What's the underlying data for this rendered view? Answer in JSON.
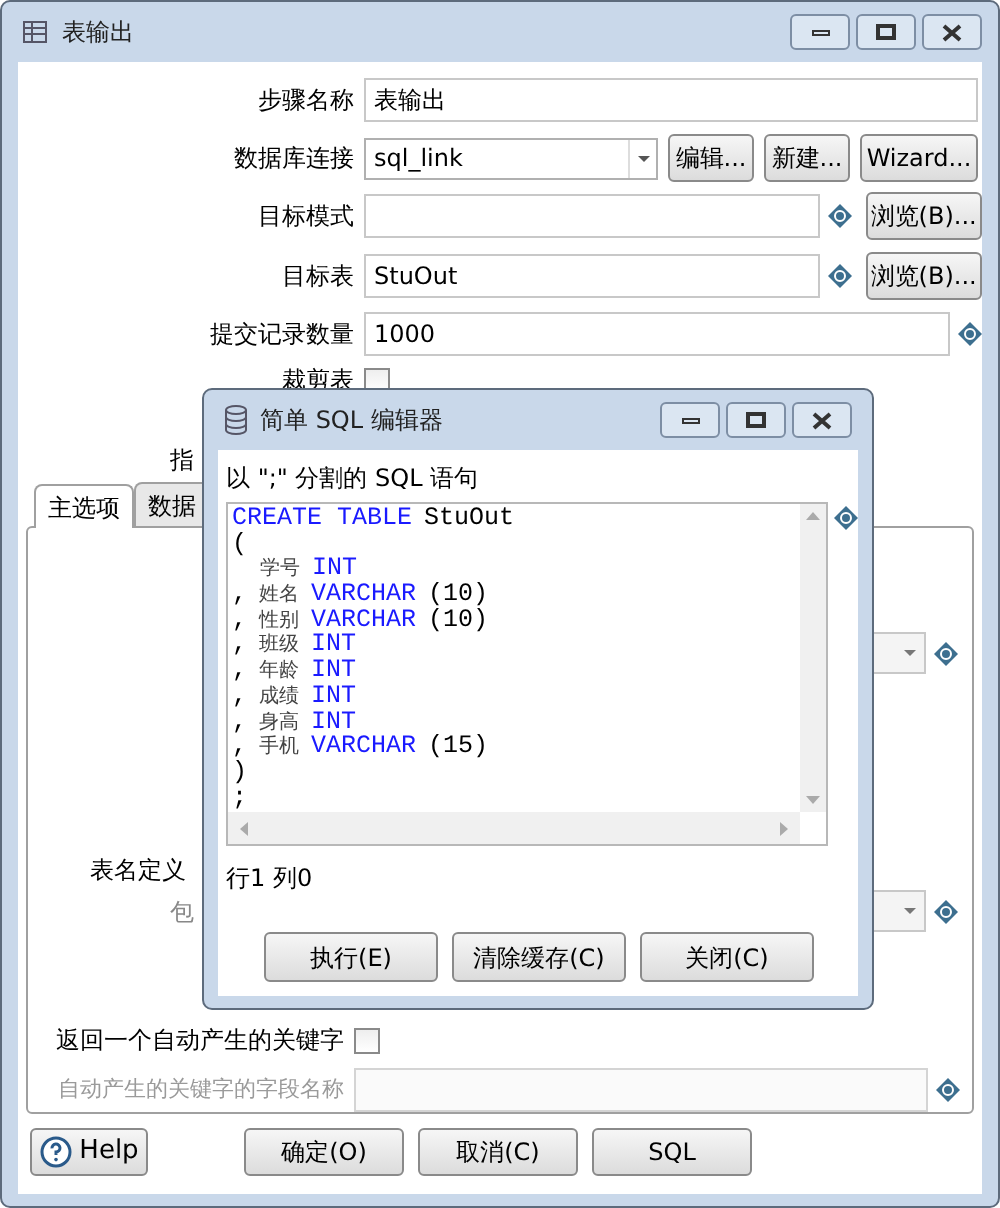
{
  "window": {
    "title": "表输出"
  },
  "form": {
    "step_name": {
      "label": "步骤名称",
      "value": "表输出"
    },
    "connection": {
      "label": "数据库连接",
      "value": "sql_link",
      "buttons": [
        "编辑...",
        "新建...",
        "Wizard..."
      ]
    },
    "target_schema": {
      "label": "目标模式",
      "button": "浏览(B)..."
    },
    "target_table": {
      "label": "目标表",
      "value": "StuOut",
      "button": "浏览(B)..."
    },
    "commit_size": {
      "label": "提交记录数量",
      "value": "1000"
    },
    "truncate": {
      "label": "裁剪表",
      "checked": false
    },
    "specify_fields": {
      "label": "指"
    }
  },
  "tabs": [
    {
      "label": "主选项",
      "selected": true
    },
    {
      "label": "数据",
      "selected": false
    }
  ],
  "tab_body": {
    "table_name_label": "表名定义",
    "package_label": "包",
    "return_key": {
      "label": "返回一个自动产生的关键字",
      "checked": false
    },
    "key_field": {
      "label": "自动产生的关键字的字段名称",
      "disabled": true
    }
  },
  "buttons": [
    {
      "kind": "help",
      "label": "Help"
    },
    {
      "kind": "plain",
      "label": "确定(O)"
    },
    {
      "kind": "plain",
      "label": "取消(C)"
    },
    {
      "kind": "plain",
      "label": "SQL"
    }
  ],
  "dialog": {
    "title": "简单 SQL 编辑器",
    "hint": "以 \";\" 分割的 SQL 语句",
    "lines": [
      {
        "tokens": [
          {
            "kind": "keyword",
            "text": "CREATE TABLE"
          },
          {
            "kind": "text",
            "text": "StuOut"
          }
        ]
      },
      {
        "tokens": [
          {
            "kind": "text",
            "text": "("
          }
        ]
      },
      {
        "tokens": [
          {
            "kind": "name",
            "text": "学号"
          },
          {
            "kind": "keyword",
            "text": "INT"
          }
        ]
      },
      {
        "tokens": [
          {
            "kind": "text",
            "text": ","
          },
          {
            "kind": "name",
            "text": "姓名"
          },
          {
            "kind": "keyword",
            "text": "VARCHAR"
          },
          {
            "kind": "text",
            "text": "(10)"
          }
        ]
      },
      {
        "tokens": [
          {
            "kind": "text",
            "text": ","
          },
          {
            "kind": "name",
            "text": "性别"
          },
          {
            "kind": "keyword",
            "text": "VARCHAR"
          },
          {
            "kind": "text",
            "text": "(10)"
          }
        ]
      },
      {
        "tokens": [
          {
            "kind": "text",
            "text": ","
          },
          {
            "kind": "name",
            "text": "班级"
          },
          {
            "kind": "keyword",
            "text": "INT"
          }
        ]
      },
      {
        "tokens": [
          {
            "kind": "text",
            "text": ","
          },
          {
            "kind": "name",
            "text": "年龄"
          },
          {
            "kind": "keyword",
            "text": "INT"
          }
        ]
      },
      {
        "tokens": [
          {
            "kind": "text",
            "text": ","
          },
          {
            "kind": "name",
            "text": "成绩"
          },
          {
            "kind": "keyword",
            "text": "INT"
          }
        ]
      },
      {
        "tokens": [
          {
            "kind": "text",
            "text": ","
          },
          {
            "kind": "name",
            "text": "身高"
          },
          {
            "kind": "keyword",
            "text": "INT"
          }
        ]
      },
      {
        "tokens": [
          {
            "kind": "text",
            "text": ","
          },
          {
            "kind": "name",
            "text": "手机"
          },
          {
            "kind": "keyword",
            "text": "VARCHAR"
          },
          {
            "kind": "text",
            "text": "(15)"
          }
        ]
      },
      {
        "tokens": [
          {
            "kind": "text",
            "text": ")"
          }
        ]
      },
      {
        "tokens": [
          {
            "kind": "text",
            "text": ";"
          }
        ]
      }
    ],
    "status": "行1 列0",
    "buttons": [
      "执行(E)",
      "清除缓存(C)",
      "关闭(C)"
    ]
  }
}
